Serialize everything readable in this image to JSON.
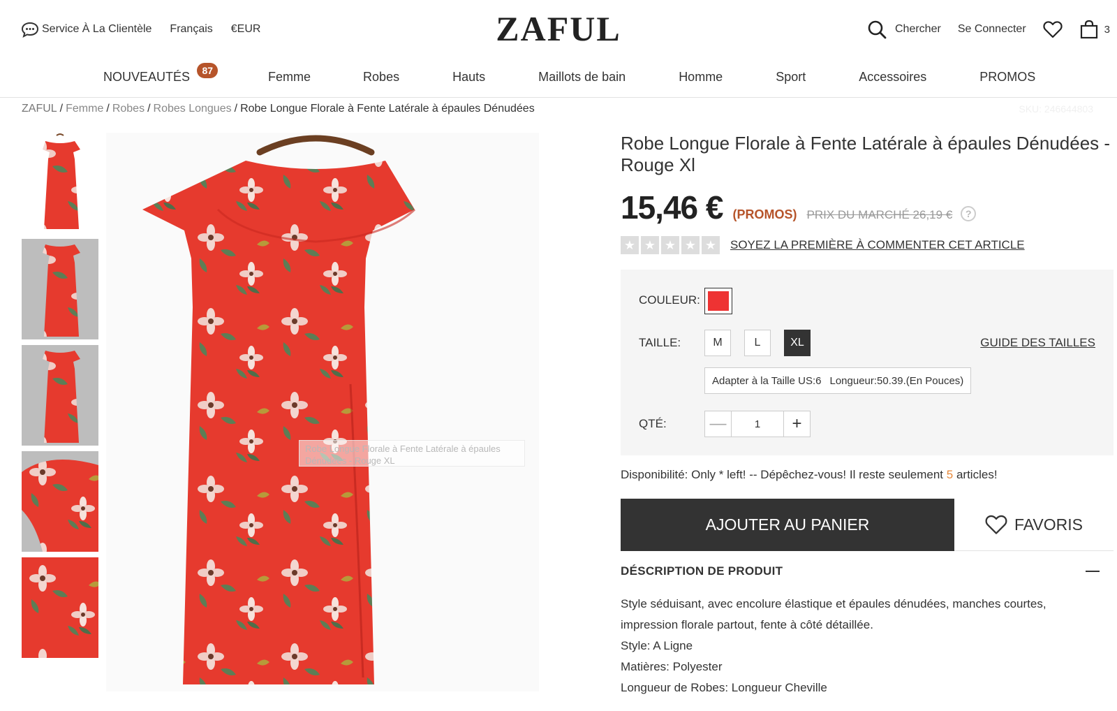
{
  "header": {
    "service_label": "Service À La Clientèle",
    "language": "Français",
    "currency": "€EUR",
    "logo": "ZAFUL",
    "search_label": "Chercher",
    "login_label": "Se Connecter",
    "bag_count": "3",
    "icons": [
      "chat-icon",
      "search-icon",
      "heart-icon",
      "bag-icon"
    ]
  },
  "nav": {
    "items": [
      {
        "label": "NOUVEAUTÉS",
        "badge": "87"
      },
      {
        "label": "Femme"
      },
      {
        "label": "Robes"
      },
      {
        "label": "Hauts"
      },
      {
        "label": "Maillots de bain"
      },
      {
        "label": "Homme"
      },
      {
        "label": "Sport"
      },
      {
        "label": "Accessoires"
      },
      {
        "label": "PROMOS"
      }
    ]
  },
  "breadcrumb": {
    "items": [
      "ZAFUL",
      "Femme",
      "Robes",
      "Robes Longues"
    ],
    "current": "Robe Longue Florale à Fente Latérale à épaules Dénudées",
    "sku": "SKU: 246644803"
  },
  "gallery": {
    "caption": "Robe Longue Florale à Fente Latérale à épaules Dénudées - Rouge XL"
  },
  "product": {
    "title": "Robe Longue Florale à Fente Latérale à épaules Dénudées - Rouge Xl",
    "price": "15,46 €",
    "promo_tag": "(PROMOS)",
    "market_price": "PRIX DU MARCHÉ 26,19 €",
    "help_symbol": "?",
    "rating_stars": 0,
    "review_link": "SOYEZ LA PREMIÈRE À COMMENTER CET ARTICLE",
    "color_label": "COULEUR:",
    "color_value": "#ee3333",
    "size_label": "TAILLE:",
    "sizes": [
      "M",
      "L",
      "XL"
    ],
    "selected_size": "XL",
    "size_guide": "GUIDE DES TAILLES",
    "fit_size": "Adapter à la Taille US:6",
    "fit_length": "Longueur:50.39.(En Pouces)",
    "qty_label": "QTÉ:",
    "qty_value": "1",
    "qty_minus": "—",
    "qty_plus": "+",
    "availability_prefix": "Disponibilité: Only * left! -- Dépêchez-vous! Il reste seulement",
    "availability_count": "5",
    "availability_suffix": "articles!",
    "add_to_cart": "AJOUTER AU PANIER",
    "favorites": "FAVORIS",
    "description_title": "DÉSCRIPTION DE PRODUIT",
    "description": [
      "Style séduisant, avec encolure élastique et épaules dénudées, manches courtes, impression florale partout, fente à côté détaillée.",
      "Style: A Ligne",
      "Matières: Polyester",
      "Longueur de Robes: Longueur Cheville"
    ]
  },
  "colors": {
    "accent": "#b6542a",
    "dark_button": "#333333",
    "dress_red": "#e63a2e",
    "stock_orange": "#e8893a"
  }
}
